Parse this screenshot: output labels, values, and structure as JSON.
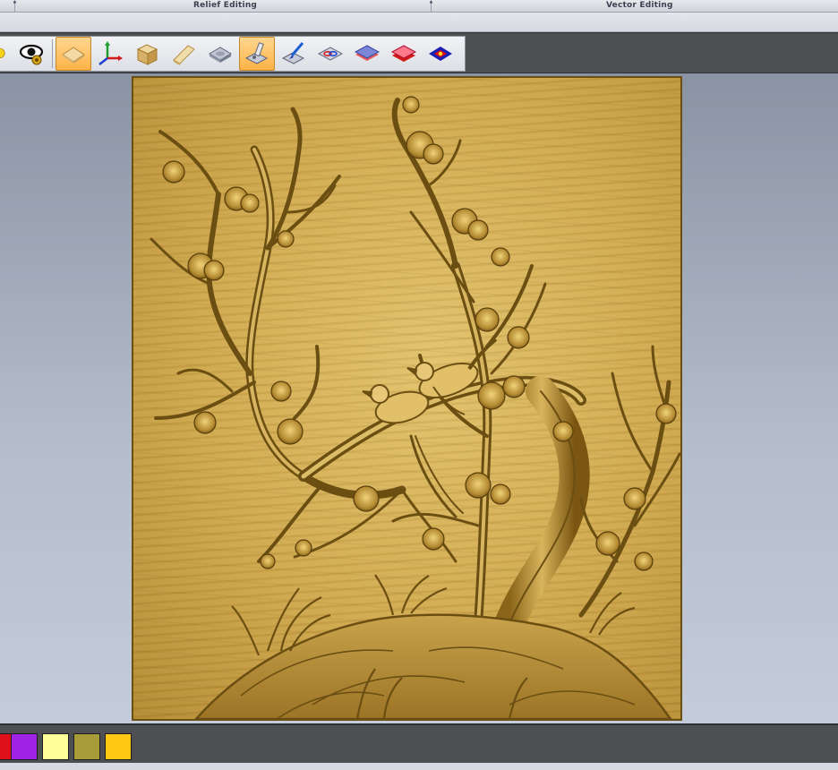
{
  "panels": {
    "relief_editing": "Relief Editing",
    "vector_editing": "Vector Editing"
  },
  "toolbar": {
    "buttons": [
      {
        "icon": "bulb-icon",
        "label": "Lighting"
      },
      {
        "icon": "eye-icon",
        "label": "View Options"
      },
      {
        "icon": "relief-plane-icon",
        "label": "Relief Plane",
        "active": true
      },
      {
        "icon": "axes-icon",
        "label": "Axes"
      },
      {
        "icon": "material-block-icon",
        "label": "Material Block"
      },
      {
        "icon": "extrude-icon",
        "label": "Extrude"
      },
      {
        "icon": "relief-layer-icon",
        "label": "Relief Layer"
      },
      {
        "icon": "sculpt-tool-icon",
        "label": "Sculpt",
        "active": true
      },
      {
        "icon": "paint-brush-icon",
        "label": "Paint"
      },
      {
        "icon": "color-select-icon",
        "label": "Color Select"
      },
      {
        "icon": "shade-layer-icon",
        "label": "Shade"
      },
      {
        "icon": "red-layer-icon",
        "label": "Color Layer"
      },
      {
        "icon": "flat-area-icon",
        "label": "Flat Area"
      }
    ]
  },
  "palette": {
    "colors": [
      "#e0101a",
      "#a022e6",
      "#ffff99",
      "#a89c3a",
      "#ffc914"
    ]
  },
  "relief": {
    "wood_color": "#d3ad52",
    "carve_color": "#6b4e12"
  }
}
